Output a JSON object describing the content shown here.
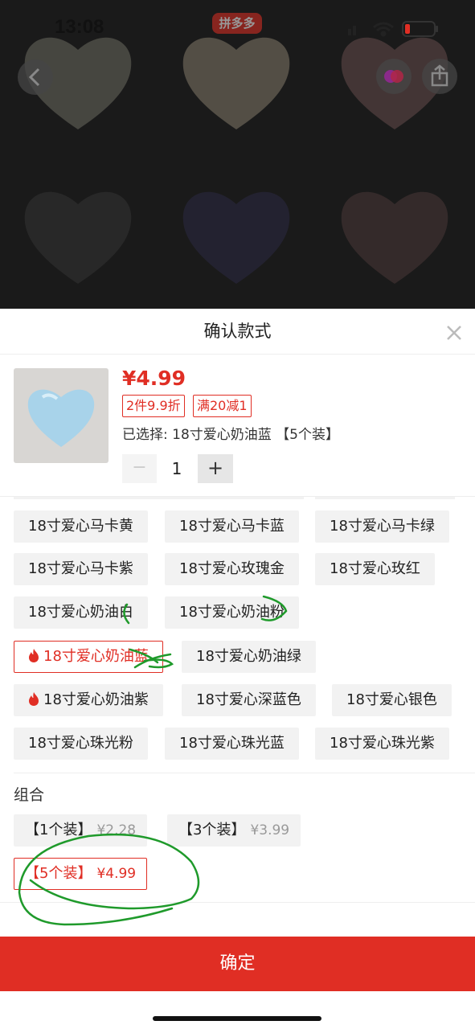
{
  "status": {
    "time": "13:08"
  },
  "header": {
    "brand": "拼多多"
  },
  "colors": {
    "accent": "#e02e24",
    "annotation": "#1f9a2b"
  },
  "gallery": {
    "tiles": [
      {
        "color": "#b9b7a9"
      },
      {
        "color": "#d9cdb5"
      },
      {
        "color": "#b08c8c"
      },
      {
        "color": "#6b6b6b"
      },
      {
        "color": "#5e5a7e"
      },
      {
        "color": "#8a6e6e"
      }
    ]
  },
  "sheet": {
    "title": "确认款式",
    "product": {
      "price": "¥4.99",
      "tags": [
        "2件9.9折",
        "满20减1"
      ],
      "selected": "已选择: 18寸爱心奶油蓝 【5个装】",
      "quantity": "1",
      "minus": "−",
      "plus": "+",
      "thumb_color": "#a8d3ea"
    },
    "style_options": [
      {
        "label": "18寸爱心马卡黄"
      },
      {
        "label": "18寸爱心马卡蓝"
      },
      {
        "label": "18寸爱心马卡绿"
      },
      {
        "label": "18寸爱心马卡紫"
      },
      {
        "label": "18寸爱心玫瑰金"
      },
      {
        "label": "18寸爱心玫红"
      },
      {
        "label": "18寸爱心奶油白"
      },
      {
        "label": "18寸爱心奶油粉"
      },
      {
        "label": "18寸爱心奶油蓝",
        "hot": true,
        "selected": true
      },
      {
        "label": "18寸爱心奶油绿"
      },
      {
        "label": "18寸爱心奶油紫",
        "hot": true
      },
      {
        "label": "18寸爱心深蓝色"
      },
      {
        "label": "18寸爱心银色"
      },
      {
        "label": "18寸爱心珠光粉"
      },
      {
        "label": "18寸爱心珠光蓝"
      },
      {
        "label": "18寸爱心珠光紫"
      }
    ],
    "group_label": "组合",
    "packs": [
      {
        "name": "【1个装】",
        "price": "¥2.28"
      },
      {
        "name": "【3个装】",
        "price": "¥3.99"
      },
      {
        "name": "【5个装】",
        "price": "¥4.99",
        "selected": true
      }
    ],
    "confirm": "确定"
  }
}
